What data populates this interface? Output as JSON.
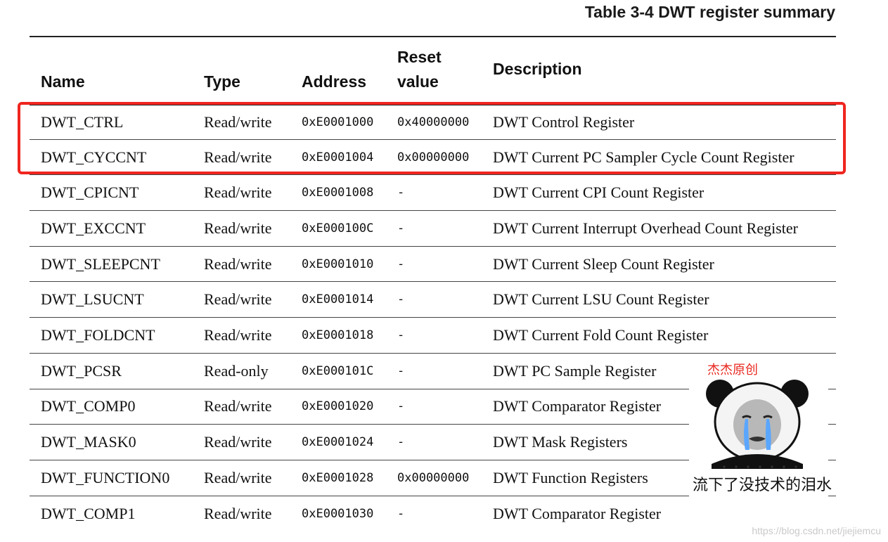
{
  "table": {
    "caption": "Table 3-4 DWT register summary",
    "headers": {
      "name": "Name",
      "type": "Type",
      "address": "Address",
      "reset_line1": "Reset",
      "reset_line2": "value",
      "description": "Description"
    },
    "rows": [
      {
        "name": "DWT_CTRL",
        "type": "Read/write",
        "address": "0xE0001000",
        "reset": "0x40000000",
        "description": "DWT Control Register"
      },
      {
        "name": "DWT_CYCCNT",
        "type": "Read/write",
        "address": "0xE0001004",
        "reset": "0x00000000",
        "description": "DWT Current PC Sampler Cycle Count Register"
      },
      {
        "name": "DWT_CPICNT",
        "type": "Read/write",
        "address": "0xE0001008",
        "reset": "-",
        "description": "DWT Current CPI Count Register"
      },
      {
        "name": "DWT_EXCCNT",
        "type": "Read/write",
        "address": "0xE000100C",
        "reset": "-",
        "description": "DWT Current Interrupt Overhead Count Register"
      },
      {
        "name": "DWT_SLEEPCNT",
        "type": "Read/write",
        "address": "0xE0001010",
        "reset": "-",
        "description": "DWT Current Sleep Count Register"
      },
      {
        "name": "DWT_LSUCNT",
        "type": "Read/write",
        "address": "0xE0001014",
        "reset": "-",
        "description": "DWT Current LSU Count Register"
      },
      {
        "name": "DWT_FOLDCNT",
        "type": "Read/write",
        "address": "0xE0001018",
        "reset": "-",
        "description": "DWT Current Fold Count Register"
      },
      {
        "name": "DWT_PCSR",
        "type": "Read-only",
        "address": "0xE000101C",
        "reset": "-",
        "description": "DWT PC Sample Register"
      },
      {
        "name": "DWT_COMP0",
        "type": "Read/write",
        "address": "0xE0001020",
        "reset": "-",
        "description": "DWT Comparator Register"
      },
      {
        "name": "DWT_MASK0",
        "type": "Read/write",
        "address": "0xE0001024",
        "reset": "-",
        "description": "DWT Mask Registers"
      },
      {
        "name": "DWT_FUNCTION0",
        "type": "Read/write",
        "address": "0xE0001028",
        "reset": "0x00000000",
        "description": "DWT Function Registers"
      },
      {
        "name": "DWT_COMP1",
        "type": "Read/write",
        "address": "0xE0001030",
        "reset": "-",
        "description": "DWT Comparator Register"
      }
    ]
  },
  "highlight_color": "#f0251f",
  "meme": {
    "top_text": "杰杰原创",
    "bottom_text": "流下了没技术的泪水",
    "top_text_color": "#e8281f"
  },
  "watermark": "https://blog.csdn.net/jiejiemcu"
}
